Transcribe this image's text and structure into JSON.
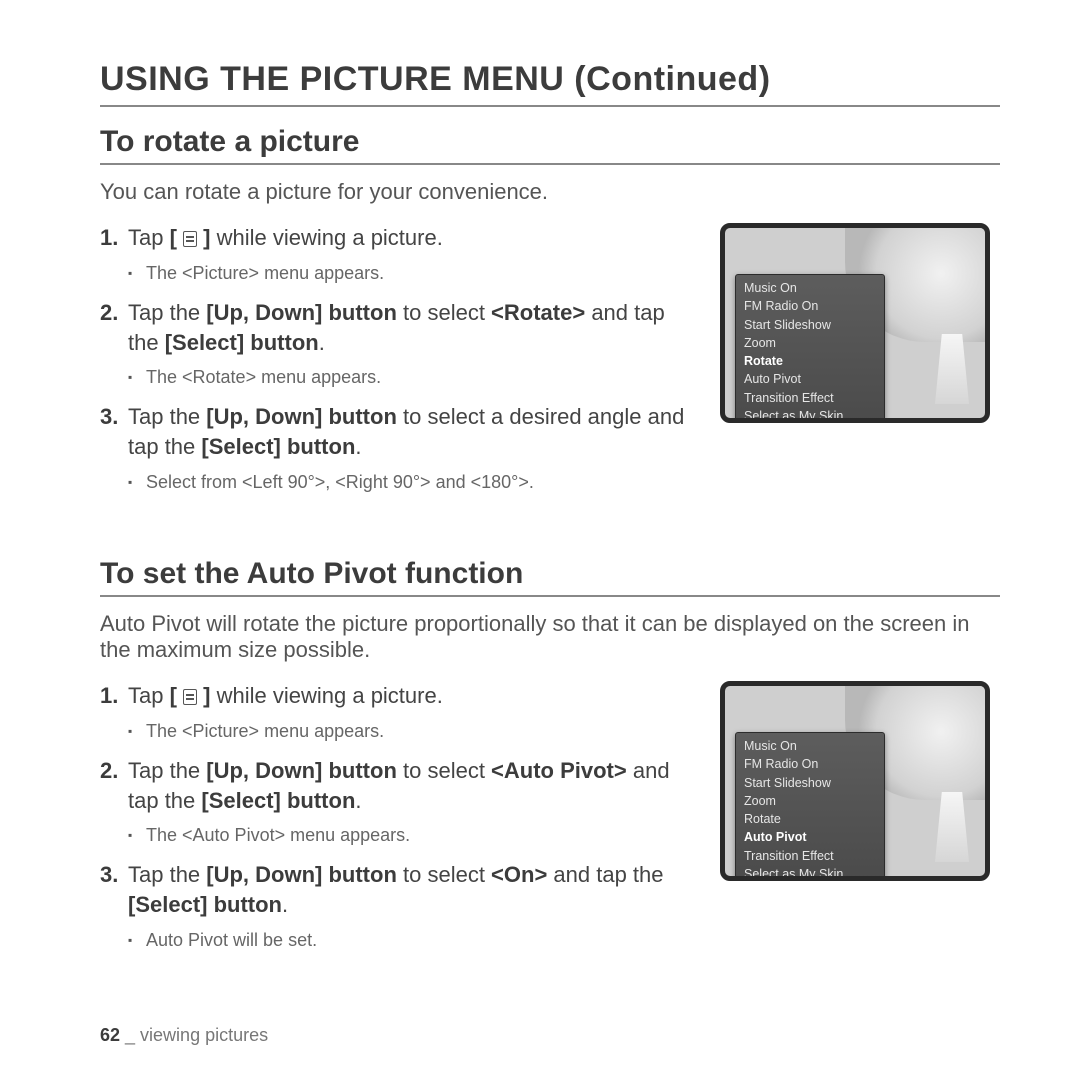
{
  "page_title": "USING THE PICTURE MENU (Continued)",
  "section1": {
    "title": "To rotate a picture",
    "intro": "You can rotate a picture for your convenience.",
    "step1_a": "Tap ",
    "step1_b": " while viewing a picture.",
    "step1_sub": "The <Picture> menu appears.",
    "step2_a": "Tap the ",
    "step2_b": "[Up, Down] button",
    "step2_c": " to select ",
    "step2_d": "<Rotate>",
    "step2_e": " and tap the ",
    "step2_f": "[Select] button",
    "step2_g": ".",
    "step2_sub": "The <Rotate> menu appears.",
    "step3_a": "Tap the ",
    "step3_b": "[Up, Down] button",
    "step3_c": " to select a desired angle and tap the ",
    "step3_d": "[Select] button",
    "step3_e": ".",
    "step3_sub": "Select from <Left 90°>, <Right 90°> and <180°>."
  },
  "section2": {
    "title": "To set the Auto Pivot function",
    "intro": "Auto Pivot will rotate the picture proportionally so that it can be displayed on the screen in the maximum size possible.",
    "step1_a": "Tap ",
    "step1_b": " while viewing a picture.",
    "step1_sub": "The <Picture> menu appears.",
    "step2_a": "Tap the ",
    "step2_b": "[Up, Down] button",
    "step2_c": " to select ",
    "step2_d": "<Auto Pivot>",
    "step2_e": " and tap the ",
    "step2_f": "[Select] button",
    "step2_g": ".",
    "step2_sub": "The <Auto Pivot> menu appears.",
    "step3_a": "Tap the ",
    "step3_b": "[Up, Down] button",
    "step3_c": " to select ",
    "step3_d": "<On>",
    "step3_e": " and tap the ",
    "step3_f": "[Select] button",
    "step3_g": ".",
    "step3_sub": "Auto Pivot will be set."
  },
  "device_menu": {
    "items": [
      "Music On",
      "FM Radio On",
      "Start Slideshow",
      "Zoom",
      "Rotate",
      "Auto Pivot",
      "Transition Effect",
      "Select as My Skin"
    ],
    "selected1": "Rotate",
    "selected2": "Auto Pivot"
  },
  "bracket_open": "[ ",
  "bracket_close": " ]",
  "footer": {
    "page": "62",
    "sep": " _ ",
    "label": "viewing pictures"
  }
}
